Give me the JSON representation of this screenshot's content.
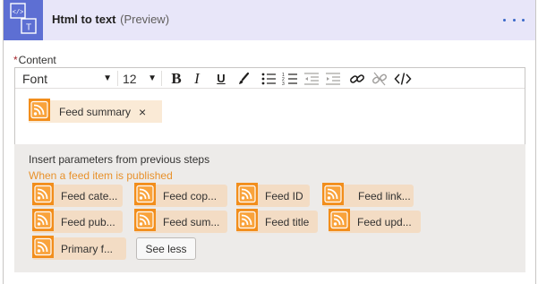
{
  "header": {
    "title": "Html to text",
    "preview": "(Preview)",
    "accent": "#5d6fd3",
    "background": "#e8e6f9",
    "icon": "html-to-text-icon"
  },
  "content_field": {
    "required_mark": "*",
    "label": "Content"
  },
  "toolbar": {
    "font_value": "Font",
    "size_value": "12",
    "bold_label": "B",
    "italic_label": "I",
    "underline_label": "U",
    "icons": [
      "paint-brush-icon",
      "bullet-list-icon",
      "numbered-list-icon",
      "decrease-indent-icon",
      "increase-indent-icon",
      "link-icon",
      "unlink-icon",
      "code-view-icon"
    ]
  },
  "content_tag": {
    "label": "Feed summary",
    "remove": "×",
    "icon": "rss-icon"
  },
  "parameters_panel": {
    "title": "Insert parameters from previous steps",
    "section_title": "When a feed item is published",
    "section_color": "#e8912b",
    "items": [
      {
        "label": "Feed cate..."
      },
      {
        "label": "Feed cop..."
      },
      {
        "label": "Feed ID"
      },
      {
        "label": "Feed link..."
      },
      {
        "label": "Feed pub..."
      },
      {
        "label": "Feed sum..."
      },
      {
        "label": "Feed title"
      },
      {
        "label": "Feed upd..."
      },
      {
        "label": "Primary f..."
      }
    ],
    "see_less_label": "See less"
  }
}
